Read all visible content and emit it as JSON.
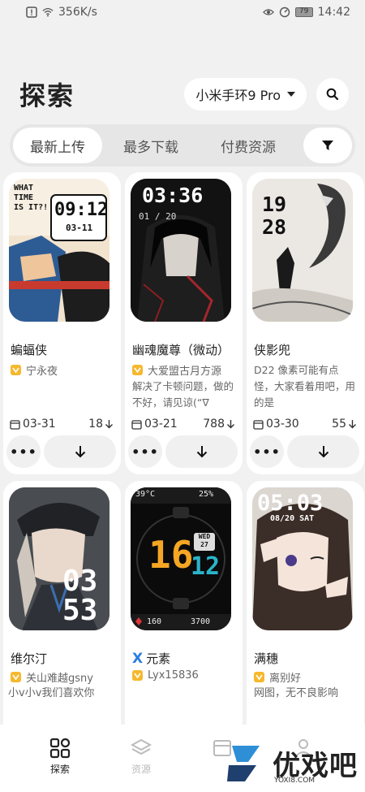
{
  "status_bar": {
    "network_speed": "356K/s",
    "battery": "79",
    "time": "14:42"
  },
  "header": {
    "title": "探索",
    "device": "小米手环9 Pro"
  },
  "tabs": [
    {
      "label": "最新上传",
      "active": true
    },
    {
      "label": "最多下载",
      "active": false
    },
    {
      "label": "付费资源",
      "active": false
    }
  ],
  "cards": [
    {
      "title": "蝙蝠侠",
      "author": "宁永夜",
      "date": "03-31",
      "downloads": "18",
      "thumb": {
        "lines": [
          "WHAT",
          "TIME",
          "IS IT?!"
        ],
        "time": "09:12",
        "date": "03-11"
      }
    },
    {
      "title": "幽魂魔尊（微动）",
      "author": "大爱盟古月方源",
      "desc": "解决了卡顿问题，做的不好，请见谅(“∇",
      "date": "03-21",
      "downloads": "788",
      "thumb": {
        "time": "03:36",
        "date": "01 / 20"
      }
    },
    {
      "title": "侠影兜",
      "author": "",
      "desc": "D22 像素可能有点怪，大家看着用吧，用的是",
      "date": "03-30",
      "downloads": "55",
      "thumb": {
        "hour": "19",
        "minute": "28"
      }
    },
    {
      "title": "维尔汀",
      "author": "关山难越gsny",
      "desc": "小v小v我们喜欢你",
      "thumb": {
        "hour": "03",
        "minute": "53"
      }
    },
    {
      "title": "元素",
      "author": "Lyx15836",
      "thumb": {
        "temp": "39°C",
        "battery": "25%",
        "hour": "16",
        "minute": "12",
        "weekday": "WED",
        "day": "27",
        "heart": "160",
        "steps": "3700"
      }
    },
    {
      "title": "满穗",
      "author": "离别好",
      "desc": "网图，无不良影响",
      "thumb": {
        "time": "05:03",
        "date": "08/20 SAT"
      }
    }
  ],
  "bottom_nav": [
    {
      "label": "探索",
      "icon": "grid-icon",
      "active": true
    },
    {
      "label": "资源",
      "icon": "layers-icon",
      "active": false
    },
    {
      "label": "",
      "icon": "store-icon",
      "active": false
    },
    {
      "label": "",
      "icon": "user-icon",
      "active": false
    }
  ],
  "watermark": {
    "text": "优戏吧",
    "url": "YOXI8.COM"
  },
  "colors": {
    "badge": "#f5b82e",
    "accent_blue": "#2a7de1",
    "background": "#f1f1f1"
  }
}
